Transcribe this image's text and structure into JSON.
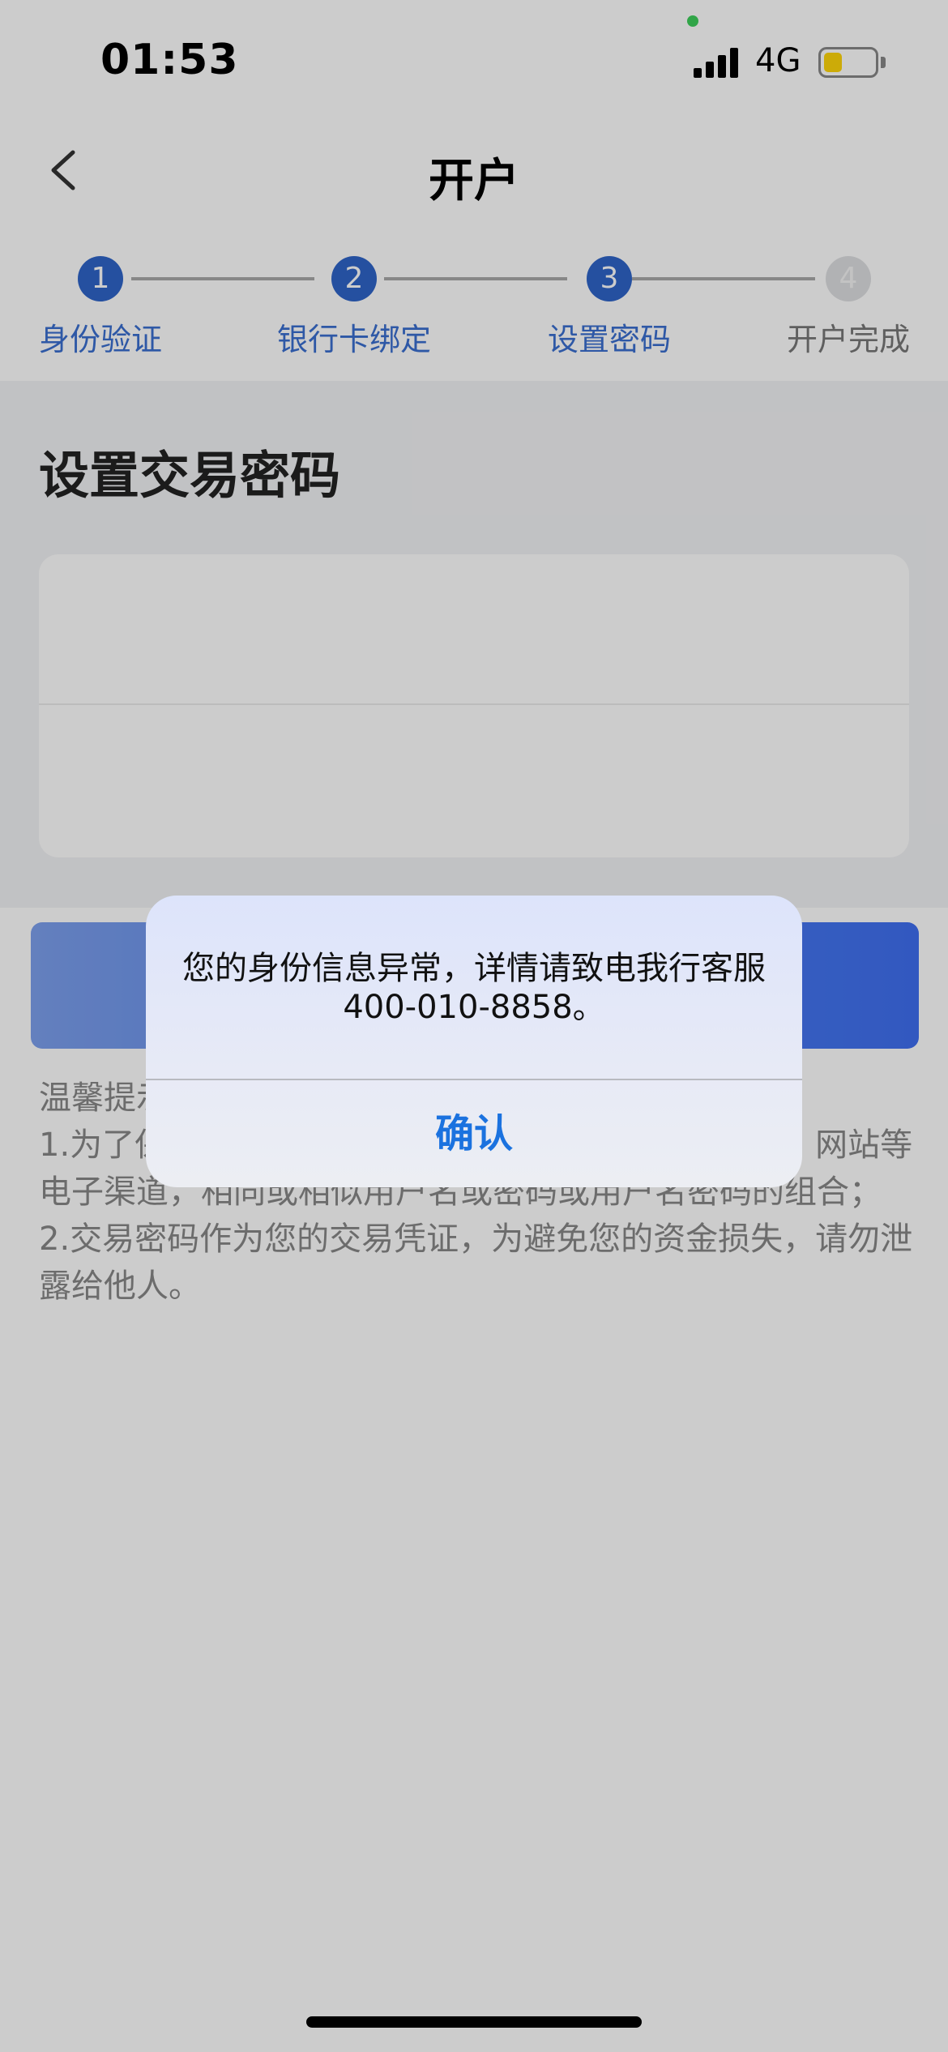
{
  "status_bar": {
    "time": "01:53",
    "network": "4G",
    "battery_level": 0.35
  },
  "nav": {
    "title": "开户",
    "back_icon": "chevron-left-icon"
  },
  "steps": [
    {
      "number": "1",
      "label": "身份验证",
      "state": "done"
    },
    {
      "number": "2",
      "label": "银行卡绑定",
      "state": "done"
    },
    {
      "number": "3",
      "label": "设置密码",
      "state": "current"
    },
    {
      "number": "4",
      "label": "开户完成",
      "state": "pending"
    }
  ],
  "section": {
    "title": "设置交易密码"
  },
  "tips": {
    "title": "温馨提示：",
    "line1": "1.为了保障您的资金安全，请勿使用与其他常用软件、网站等电子渠道，相同或相似用户名或密码或用户名密码的组合；",
    "line2": "2.交易密码作为您的交易凭证，为避免您的资金损失，请勿泄露给他人。"
  },
  "alert": {
    "message": "您的身份信息异常，详情请致电我行客服400-010-8858。",
    "confirm_label": "确认"
  },
  "colors": {
    "accent": "#2f64c8",
    "alert_button": "#1b72df",
    "battery": "#ffd60a"
  }
}
